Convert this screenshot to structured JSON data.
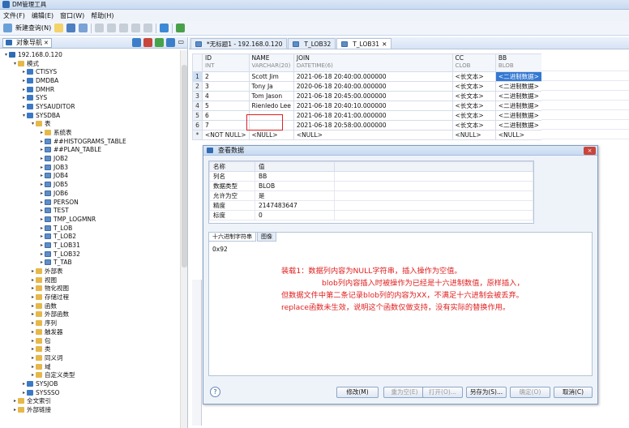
{
  "window": {
    "title": "DM管理工具"
  },
  "menu": [
    "文件(F)",
    "编辑(E)",
    "窗口(W)",
    "帮助(H)"
  ],
  "toolbar": {
    "new_query": "新建查询(N)"
  },
  "left_panel": {
    "tab_label": "对象导航",
    "tree": [
      {
        "label": "192.168.0.120",
        "level": 0,
        "icon": "server-icon",
        "twisty": "▾"
      },
      {
        "label": "模式",
        "level": 1,
        "icon": "folder-icon",
        "twisty": "▾"
      },
      {
        "label": "CTISYS",
        "level": 2,
        "icon": "schema-icon",
        "twisty": "▸"
      },
      {
        "label": "DMDBA",
        "level": 2,
        "icon": "schema-icon",
        "twisty": "▸"
      },
      {
        "label": "DMHR",
        "level": 2,
        "icon": "schema-icon",
        "twisty": "▸"
      },
      {
        "label": "SYS",
        "level": 2,
        "icon": "schema-icon",
        "twisty": "▸"
      },
      {
        "label": "SYSAUDITOR",
        "level": 2,
        "icon": "schema-icon",
        "twisty": "▸"
      },
      {
        "label": "SYSDBA",
        "level": 2,
        "icon": "schema-icon",
        "twisty": "▾"
      },
      {
        "label": "表",
        "level": 3,
        "icon": "folder-icon",
        "twisty": "▾"
      },
      {
        "label": "系统表",
        "level": 4,
        "icon": "folder-icon",
        "twisty": "▸"
      },
      {
        "label": "##HISTOGRAMS_TABLE",
        "level": 4,
        "icon": "table-icon",
        "twisty": "▸"
      },
      {
        "label": "##PLAN_TABLE",
        "level": 4,
        "icon": "table-icon",
        "twisty": "▸"
      },
      {
        "label": "JOB2",
        "level": 4,
        "icon": "table-icon",
        "twisty": "▸"
      },
      {
        "label": "JOB3",
        "level": 4,
        "icon": "table-icon",
        "twisty": "▸"
      },
      {
        "label": "JOB4",
        "level": 4,
        "icon": "table-icon",
        "twisty": "▸"
      },
      {
        "label": "JOB5",
        "level": 4,
        "icon": "table-icon",
        "twisty": "▸"
      },
      {
        "label": "JOB6",
        "level": 4,
        "icon": "table-icon",
        "twisty": "▸"
      },
      {
        "label": "PERSON",
        "level": 4,
        "icon": "table-icon",
        "twisty": "▸"
      },
      {
        "label": "TEST",
        "level": 4,
        "icon": "table-icon",
        "twisty": "▸"
      },
      {
        "label": "TMP_LOGMNR",
        "level": 4,
        "icon": "table-icon",
        "twisty": "▸"
      },
      {
        "label": "T_LOB",
        "level": 4,
        "icon": "table-icon",
        "twisty": "▸"
      },
      {
        "label": "T_LOB2",
        "level": 4,
        "icon": "table-icon",
        "twisty": "▸"
      },
      {
        "label": "T_LOB31",
        "level": 4,
        "icon": "table-icon",
        "twisty": "▸"
      },
      {
        "label": "T_LOB32",
        "level": 4,
        "icon": "table-icon",
        "twisty": "▸"
      },
      {
        "label": "T_TAB",
        "level": 4,
        "icon": "table-icon",
        "twisty": "▸"
      },
      {
        "label": "外部表",
        "level": 3,
        "icon": "folder-icon",
        "twisty": "▸"
      },
      {
        "label": "视图",
        "level": 3,
        "icon": "folder-icon",
        "twisty": "▸"
      },
      {
        "label": "物化视图",
        "level": 3,
        "icon": "folder-icon",
        "twisty": "▸"
      },
      {
        "label": "存储过程",
        "level": 3,
        "icon": "folder-icon",
        "twisty": "▸"
      },
      {
        "label": "函数",
        "level": 3,
        "icon": "folder-icon",
        "twisty": "▸"
      },
      {
        "label": "外部函数",
        "level": 3,
        "icon": "folder-icon",
        "twisty": "▸"
      },
      {
        "label": "序列",
        "level": 3,
        "icon": "folder-icon",
        "twisty": "▸"
      },
      {
        "label": "触发器",
        "level": 3,
        "icon": "folder-icon",
        "twisty": "▸"
      },
      {
        "label": "包",
        "level": 3,
        "icon": "folder-icon",
        "twisty": "▸"
      },
      {
        "label": "类",
        "level": 3,
        "icon": "folder-icon",
        "twisty": "▸"
      },
      {
        "label": "同义词",
        "level": 3,
        "icon": "folder-icon",
        "twisty": "▸"
      },
      {
        "label": "域",
        "level": 3,
        "icon": "folder-icon",
        "twisty": "▸"
      },
      {
        "label": "自定义类型",
        "level": 3,
        "icon": "folder-icon",
        "twisty": "▸"
      },
      {
        "label": "SYSJOB",
        "level": 2,
        "icon": "schema-icon",
        "twisty": "▸"
      },
      {
        "label": "SYSSSO",
        "level": 2,
        "icon": "schema-icon",
        "twisty": "▸"
      },
      {
        "label": "全文索引",
        "level": 1,
        "icon": "folder-icon",
        "twisty": "▸"
      },
      {
        "label": "外部链接",
        "level": 1,
        "icon": "folder-icon",
        "twisty": "▸"
      }
    ]
  },
  "editor_tabs": [
    {
      "label": "*无标题1 - 192.168.0.120",
      "active": false
    },
    {
      "label": "T_LOB32",
      "active": false
    },
    {
      "label": "T_LOB31",
      "active": true
    }
  ],
  "grid": {
    "columns": [
      {
        "name": "ID",
        "type": "INT"
      },
      {
        "name": "NAME",
        "type": "VARCHAR(20)"
      },
      {
        "name": "JOIN",
        "type": "DATETIME(6)"
      },
      {
        "name": "CC",
        "type": "CLOB"
      },
      {
        "name": "BB",
        "type": "BLOB"
      }
    ],
    "rows": [
      {
        "rn": "1",
        "id": "2",
        "name": "Scott Jim",
        "join": "2021-06-18 20:40:00.000000",
        "cc": "<长文本>",
        "bb": "<二进制数据>"
      },
      {
        "rn": "2",
        "id": "3",
        "name": "Tony Ja",
        "join": "2020-06-18 20:40:00.000000",
        "cc": "<长文本>",
        "bb": "<二进制数据>"
      },
      {
        "rn": "3",
        "id": "4",
        "name": "Tom Jason",
        "join": "2021-06-18 20:45:00.000000",
        "cc": "<长文本>",
        "bb": "<二进制数据>"
      },
      {
        "rn": "4",
        "id": "5",
        "name": "Rienledo Lee",
        "join": "2021-06-18 20:40:10.000000",
        "cc": "<长文本>",
        "bb": "<二进制数据>"
      },
      {
        "rn": "5",
        "id": "6",
        "name": "",
        "join": "2021-06-18 20:41:00.000000",
        "cc": "<长文本>",
        "bb": "<二进制数据>"
      },
      {
        "rn": "6",
        "id": "7",
        "name": "",
        "join": "2021-06-18 20:58:00.000000",
        "cc": "<长文本>",
        "bb": "<二进制数据>"
      },
      {
        "rn": "*",
        "id": "<NOT NULL>",
        "name": "<NULL>",
        "join": "<NULL>",
        "cc": "<NULL>",
        "bb": "<NULL>"
      }
    ]
  },
  "dialog": {
    "title": "查看数据",
    "close": "×",
    "prop_headers": [
      "名称",
      "值"
    ],
    "props": [
      {
        "k": "列名",
        "v": "BB"
      },
      {
        "k": "数据类型",
        "v": "BLOB"
      },
      {
        "k": "允许为空",
        "v": "是"
      },
      {
        "k": "精度",
        "v": "2147483647"
      },
      {
        "k": "标度",
        "v": "0"
      }
    ],
    "tabs": [
      "十六进制字符串",
      "图像"
    ],
    "hex_value": "0x92",
    "note_lines": [
      "装载1：数据列内容为NULL字符串，插入操作为空值。",
      "blob列内容插入时被操作为已经是十六进制数值，原样插入，",
      "但数据文件中第二条记录blob列的内容为XX，不满足十六进制会被丢弃。",
      "replace函数未生效，说明这个函数仅做支持，没有实际的替换作用。"
    ],
    "help": "?",
    "buttons": {
      "modify": "修改(M)",
      "reset": "重为空(E)",
      "open": "打开(O)...",
      "save_as": "另存为(S)...",
      "ok": "确定(O)",
      "cancel": "取消(C)"
    }
  },
  "colors": {
    "accent": "#3478d2",
    "note_red": "#e02020"
  }
}
